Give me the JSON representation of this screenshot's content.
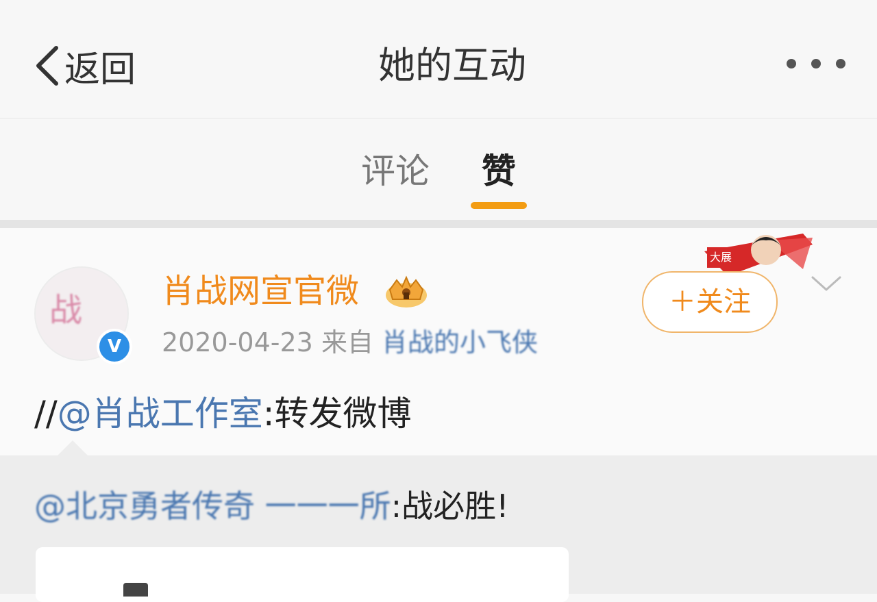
{
  "header": {
    "back_label": "返回",
    "title": "她的互动"
  },
  "tabs": [
    {
      "label": "评论",
      "active": false
    },
    {
      "label": "赞",
      "active": true
    }
  ],
  "accent_color": "#f39c12",
  "post": {
    "avatar_icon": "avatar-image",
    "verified_badge": "V",
    "username": "肖战网宣官微",
    "crown_icon": "crown-icon",
    "date": "2020-04-23",
    "source_prefix": "来自",
    "source_name": "肖战的小飞侠",
    "follow_label": "＋关注",
    "text_prefix": "//",
    "mention": "@肖战工作室",
    "text_suffix": ":转发微博",
    "quote": {
      "mention": "@北京勇者传奇 一一一所",
      "text": ":战必胜!"
    }
  }
}
